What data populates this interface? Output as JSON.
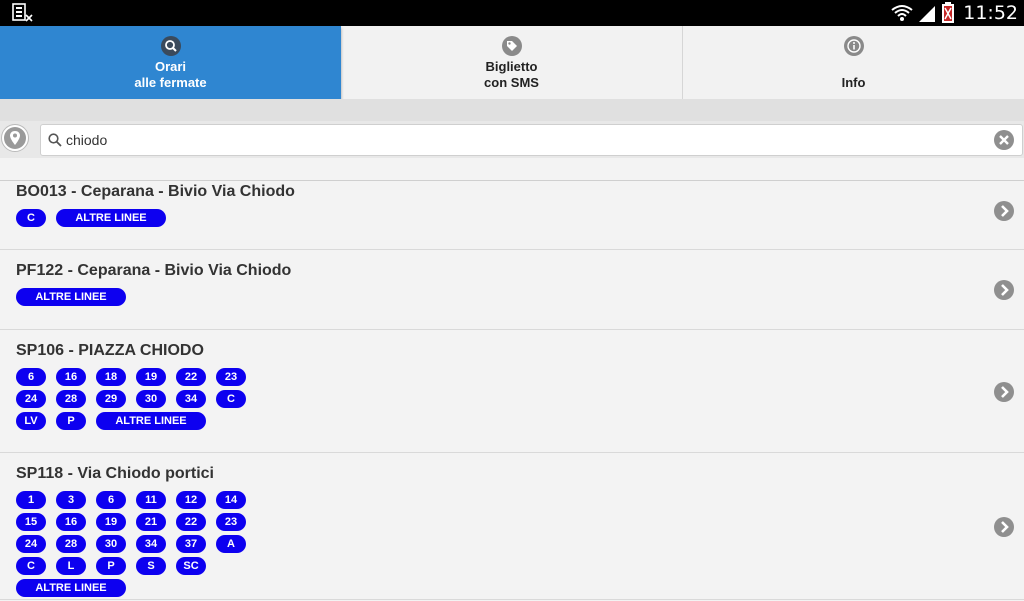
{
  "status_bar": {
    "time": "11:52",
    "icons": [
      "sim-card-error-icon",
      "wifi-icon",
      "signal-icon",
      "battery-icon"
    ]
  },
  "tabs": [
    {
      "label": "Orari\nalle fermate",
      "icon": "search-icon",
      "active": true
    },
    {
      "label": "Biglietto\ncon SMS",
      "icon": "tag-icon",
      "active": false
    },
    {
      "label": "Info",
      "icon": "info-icon",
      "active": false
    }
  ],
  "search": {
    "value": "chiodo",
    "icons": [
      "location-pin-icon",
      "search-icon",
      "clear-icon"
    ]
  },
  "results": [
    {
      "title": "BO013 - Ceparana - Bivio Via Chiodo",
      "lines": [
        "C"
      ],
      "more": "ALTRE LINEE"
    },
    {
      "title": "PF122 - Ceparana - Bivio Via Chiodo",
      "lines": [],
      "more": "ALTRE LINEE"
    },
    {
      "title": "SP106 - PIAZZA CHIODO",
      "lines": [
        "6",
        "16",
        "18",
        "19",
        "22",
        "23",
        "24",
        "28",
        "29",
        "30",
        "34",
        "C",
        "LV",
        "P"
      ],
      "more": "ALTRE LINEE"
    },
    {
      "title": "SP118 - Via Chiodo portici",
      "lines": [
        "1",
        "3",
        "6",
        "11",
        "12",
        "14",
        "15",
        "16",
        "19",
        "21",
        "22",
        "23",
        "24",
        "28",
        "30",
        "34",
        "37",
        "A",
        "C",
        "L",
        "P",
        "S",
        "SC"
      ],
      "more": "ALTRE LINEE"
    }
  ],
  "colors": {
    "accent": "#2f86d1",
    "badge": "#0d00f0",
    "background": "#f3f3f3"
  }
}
